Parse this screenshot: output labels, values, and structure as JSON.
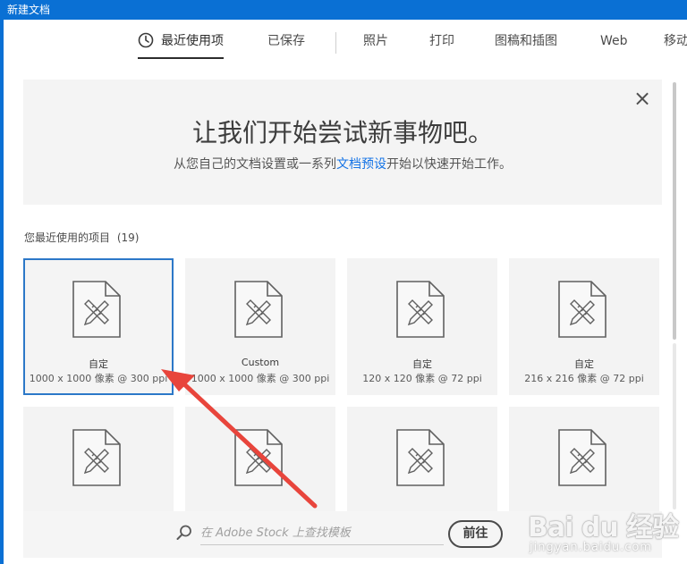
{
  "window": {
    "title": "新建文档"
  },
  "tabs": [
    {
      "label": "最近使用项",
      "active": true,
      "icon": "clock-icon"
    },
    {
      "label": "已保存"
    },
    {
      "label": "照片"
    },
    {
      "label": "打印"
    },
    {
      "label": "图稿和插图"
    },
    {
      "label": "Web"
    },
    {
      "label": "移动"
    }
  ],
  "banner": {
    "title": "让我们开始尝试新事物吧。",
    "subtitle_before": "从您自己的文档设置或一系列",
    "subtitle_link": "文档预设",
    "subtitle_after": "开始以快速开始工作。",
    "close_icon": "close-icon"
  },
  "recent": {
    "label": "您最近使用的项目",
    "count": "(19)",
    "items": [
      {
        "name": "自定",
        "size": "1000 x 1000 像素 @ 300 ppi",
        "selected": true
      },
      {
        "name": "Custom",
        "size": "1000 x 1000 像素 @ 300 ppi"
      },
      {
        "name": "自定",
        "size": "120 x 120 像素 @ 72 ppi"
      },
      {
        "name": "自定",
        "size": "216 x 216 像素 @ 72 ppi"
      },
      {
        "name": "",
        "size": ""
      },
      {
        "name": "",
        "size": ""
      },
      {
        "name": "",
        "size": ""
      },
      {
        "name": "",
        "size": ""
      }
    ]
  },
  "stock": {
    "placeholder": "在 Adobe Stock 上查找模板",
    "go_label": "前往",
    "search_icon": "search-icon"
  },
  "watermark": {
    "logo": "Bai du 经验",
    "url": "jingyan.baidu.com"
  },
  "colors": {
    "titlebar": "#0a70d4",
    "link": "#1473e6",
    "selection": "#2c78c8",
    "arrow": "#e8453c"
  }
}
